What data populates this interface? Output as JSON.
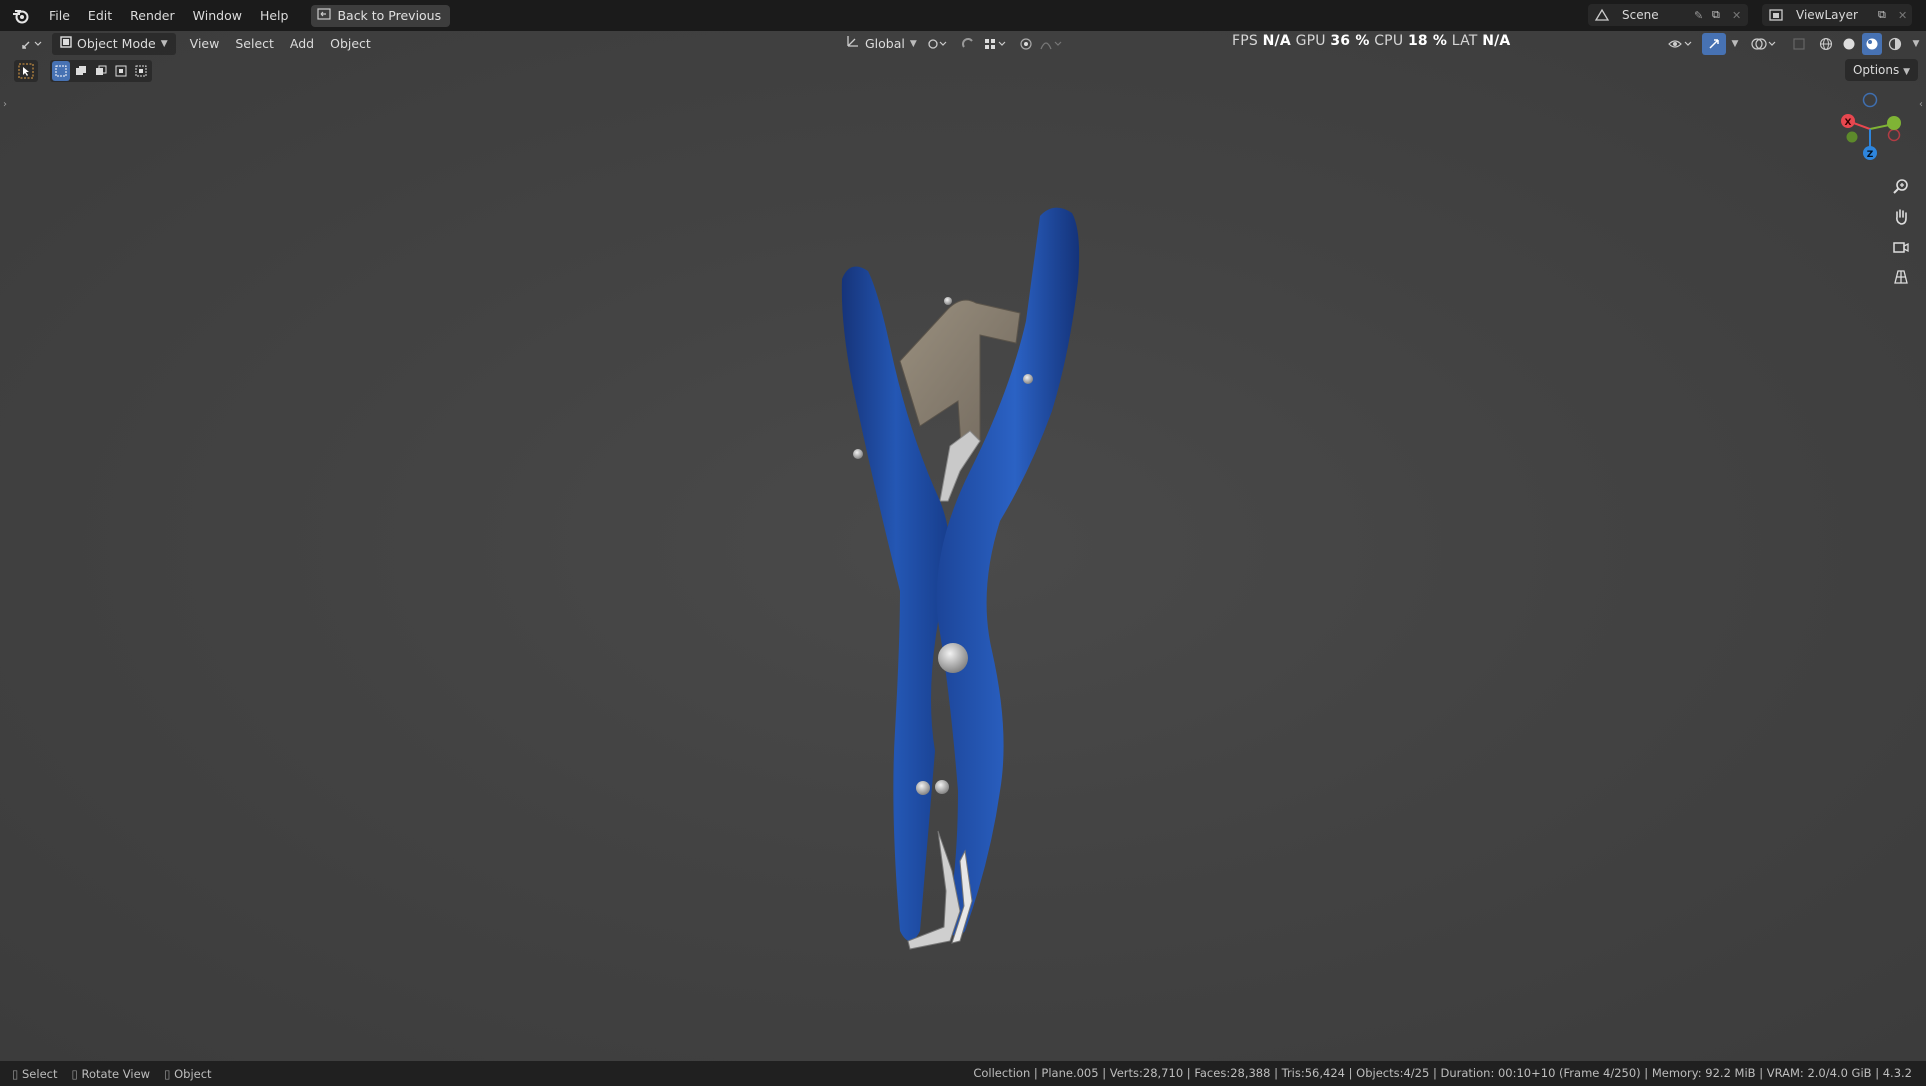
{
  "topbar": {
    "menus": [
      "File",
      "Edit",
      "Render",
      "Window",
      "Help"
    ],
    "back_label": "Back to Previous",
    "scene_name": "Scene",
    "view_layer": "ViewLayer"
  },
  "header": {
    "mode": "Object Mode",
    "menus": [
      "View",
      "Select",
      "Add",
      "Object"
    ],
    "transform_orientation": "Global",
    "options_label": "Options"
  },
  "stats": {
    "fps_label": "FPS",
    "fps_value": "N/A",
    "gpu_label": "GPU",
    "gpu_value": "36 %",
    "cpu_label": "CPU",
    "cpu_value": "18 %",
    "lat_label": "LAT",
    "lat_value": "N/A"
  },
  "gizmo": {
    "x": "X",
    "y": "Y",
    "z": "Z",
    "colors": {
      "x": "#e8474f",
      "y": "#7fb435",
      "z": "#2e86de",
      "neg": "#4a77b8"
    }
  },
  "statusbar": {
    "hints": [
      "Select",
      "Rotate View",
      "Object"
    ],
    "info": "Collection | Plane.005 | Verts:28,710 | Faces:28,388 | Tris:56,424 | Objects:4/25 | Duration: 00:10+10 (Frame 4/250) | Memory: 92.2 MiB | VRAM: 2.0/4.0 GiB | 4.3.2"
  },
  "colors": {
    "accent": "#4772b3",
    "handle_blue": "#1f4fa6",
    "metal": "#8d8376"
  }
}
